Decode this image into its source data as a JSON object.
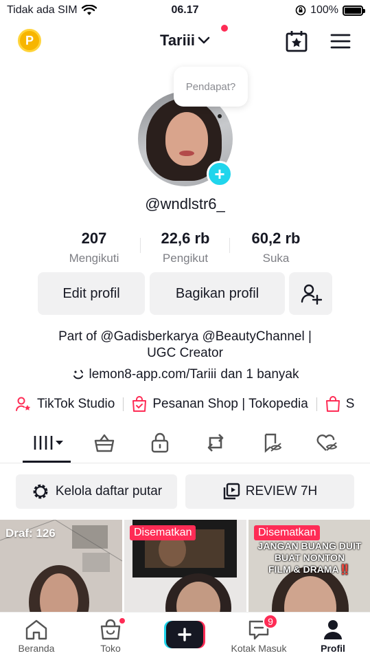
{
  "status_bar": {
    "carrier": "Tidak ada SIM",
    "time": "06.17",
    "battery": "100%"
  },
  "header": {
    "account_name": "Tariii",
    "coin_label": "P"
  },
  "profile": {
    "bubble_text": "Pendapat?",
    "username": "@wndlstr6_",
    "stats": [
      {
        "value": "207",
        "label": "Mengikuti"
      },
      {
        "value": "22,6 rb",
        "label": "Pengikut"
      },
      {
        "value": "60,2 rb",
        "label": "Suka"
      }
    ],
    "edit_button": "Edit profil",
    "share_button": "Bagikan profil",
    "bio_line1": "Part of @Gadisberkarya @BeautyChannel |",
    "bio_line2": "UGC Creator",
    "link_text": "lemon8-app.com/Tariii",
    "link_more": "dan 1 banyak"
  },
  "shortcuts": [
    {
      "label": "TikTok Studio",
      "icon": "person-star-icon"
    },
    {
      "label": "Pesanan Shop | Tokopedia",
      "icon": "shopping-bag-check-icon"
    },
    {
      "label": "S",
      "icon": "shopping-bag-icon"
    }
  ],
  "tabs": [
    {
      "name": "videos",
      "icon": "grid-icon"
    },
    {
      "name": "shop",
      "icon": "basket-icon"
    },
    {
      "name": "private",
      "icon": "lock-icon"
    },
    {
      "name": "reposts",
      "icon": "repost-icon"
    },
    {
      "name": "favorites",
      "icon": "bookmark-hidden-icon"
    },
    {
      "name": "liked",
      "icon": "heart-hidden-icon"
    }
  ],
  "playlist": {
    "manage_label": "Kelola daftar putar",
    "review_label": "REVIEW 7H"
  },
  "grid": {
    "draft_label": "Draf: 126",
    "pinned_label": "Disematkan",
    "overlay_line1": "JANGAN BUANG DUIT",
    "overlay_line2": "BUAT NONTON",
    "overlay_line3": "FILM & DRAMA‼️"
  },
  "bottom_nav": [
    {
      "label": "Beranda",
      "icon": "home-icon"
    },
    {
      "label": "Toko",
      "icon": "shop-icon"
    },
    {
      "label": "",
      "icon": "plus-icon"
    },
    {
      "label": "Kotak Masuk",
      "icon": "inbox-icon",
      "badge": "9"
    },
    {
      "label": "Profil",
      "icon": "profile-icon"
    }
  ],
  "colors": {
    "accent": "#fe2c55",
    "cyan": "#20d5ec",
    "button_bg": "#f1f1f2",
    "text": "#161823"
  }
}
